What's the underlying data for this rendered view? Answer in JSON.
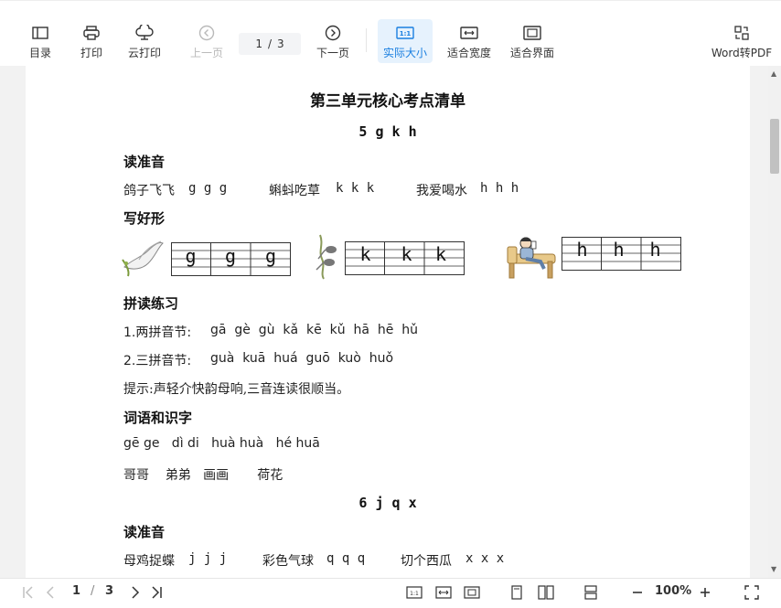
{
  "toolbar": {
    "toc": "目录",
    "print": "打印",
    "cloud_print": "云打印",
    "prev_page": "上一页",
    "page_current": "1",
    "page_sep": "/",
    "page_total": "3",
    "next_page": "下一页",
    "actual_size": "实际大小",
    "actual_size_badge": "1:1",
    "fit_width": "适合宽度",
    "fit_page": "适合界面",
    "word_to_pdf": "Word转PDF"
  },
  "document": {
    "title": "第三单元核心考点清单",
    "section1": {
      "title": "5 g k h",
      "read_heading": "读准音",
      "read_line": {
        "a_cn": "鸽子飞飞",
        "a_py": "g g g",
        "b_cn": "蝌蚪吃草",
        "b_py": "k k k",
        "c_cn": "我爱喝水",
        "c_py": "h h h"
      },
      "write_heading": "写好形",
      "grid_g": [
        "g",
        "g",
        "g"
      ],
      "grid_k": [
        "k",
        "k",
        "k"
      ],
      "grid_h": [
        "h",
        "h",
        "h"
      ],
      "practice_heading": "拼读练习",
      "two_label": "1.两拼音节:",
      "two_syllables": "gā  gè  gù  kǎ  kē  kǔ  hā  hē  hǔ",
      "three_label": "2.三拼音节:",
      "three_syllables": "guà  kuā  huá  guō  kuò  huǒ",
      "tip": "提示:声轻介快韵母响,三音连读很顺当。",
      "words_heading": "词语和识字",
      "words_pinyin": "gē ge   dì di   huà huà   hé huā",
      "words_hanzi": "哥哥    弟弟   画画       荷花"
    },
    "section2": {
      "title": "6 j q x",
      "read_heading": "读准音",
      "read_line": {
        "a_cn": "母鸡捉蝶",
        "a_py": "j j j",
        "b_cn": "彩色气球",
        "b_py": "q q q",
        "c_cn": "切个西瓜",
        "c_py": "x x x"
      }
    }
  },
  "bottombar": {
    "page_current": "1",
    "page_sep": "/",
    "page_total": "3",
    "zoom": "100%",
    "badge": "1:1"
  },
  "colors": {
    "accent": "#1a7fe0",
    "active_bg": "#e6f2fd",
    "text": "#333333",
    "disabled": "#b9b9b9"
  }
}
